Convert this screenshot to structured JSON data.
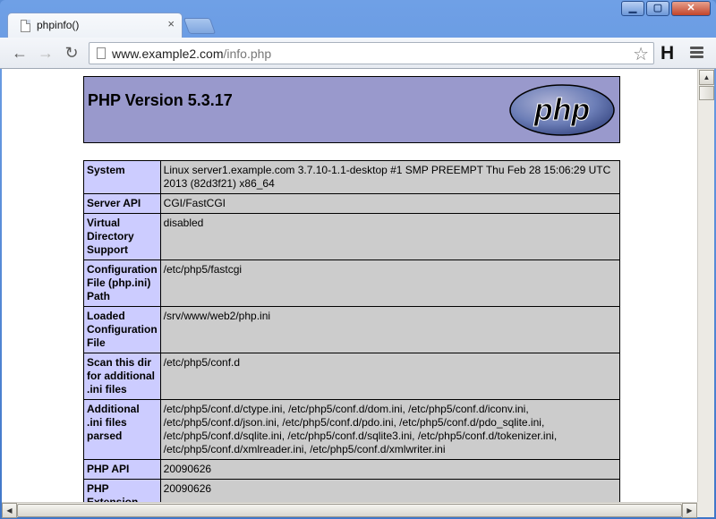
{
  "tab": {
    "title": "phpinfo()",
    "close": "×"
  },
  "window_buttons": {
    "minimize": "▁",
    "maximize": "▢",
    "close": "✕"
  },
  "toolbar": {
    "back": "←",
    "forward": "→",
    "reload": "↻",
    "url_host": "www.example2.com",
    "url_path": "/info.php",
    "star": "☆",
    "extension": "H"
  },
  "page": {
    "heading": "PHP Version 5.3.17",
    "logo_text": "php",
    "rows": [
      {
        "label": "System",
        "value": "Linux server1.example.com 3.7.10-1.1-desktop #1 SMP PREEMPT Thu Feb 28 15:06:29 UTC 2013 (82d3f21) x86_64"
      },
      {
        "label": "Server API",
        "value": "CGI/FastCGI"
      },
      {
        "label": "Virtual Directory Support",
        "value": "disabled"
      },
      {
        "label": "Configuration File (php.ini) Path",
        "value": "/etc/php5/fastcgi"
      },
      {
        "label": "Loaded Configuration File",
        "value": "/srv/www/web2/php.ini"
      },
      {
        "label": "Scan this dir for additional .ini files",
        "value": "/etc/php5/conf.d"
      },
      {
        "label": "Additional .ini files parsed",
        "value": "/etc/php5/conf.d/ctype.ini, /etc/php5/conf.d/dom.ini, /etc/php5/conf.d/iconv.ini, /etc/php5/conf.d/json.ini, /etc/php5/conf.d/pdo.ini, /etc/php5/conf.d/pdo_sqlite.ini, /etc/php5/conf.d/sqlite.ini, /etc/php5/conf.d/sqlite3.ini, /etc/php5/conf.d/tokenizer.ini, /etc/php5/conf.d/xmlreader.ini, /etc/php5/conf.d/xmlwriter.ini"
      },
      {
        "label": "PHP API",
        "value": "20090626"
      },
      {
        "label": "PHP Extension",
        "value": "20090626"
      }
    ]
  },
  "colors": {
    "header_bg": "#9999cc",
    "label_bg": "#ccccff",
    "value_bg": "#cccccc"
  }
}
